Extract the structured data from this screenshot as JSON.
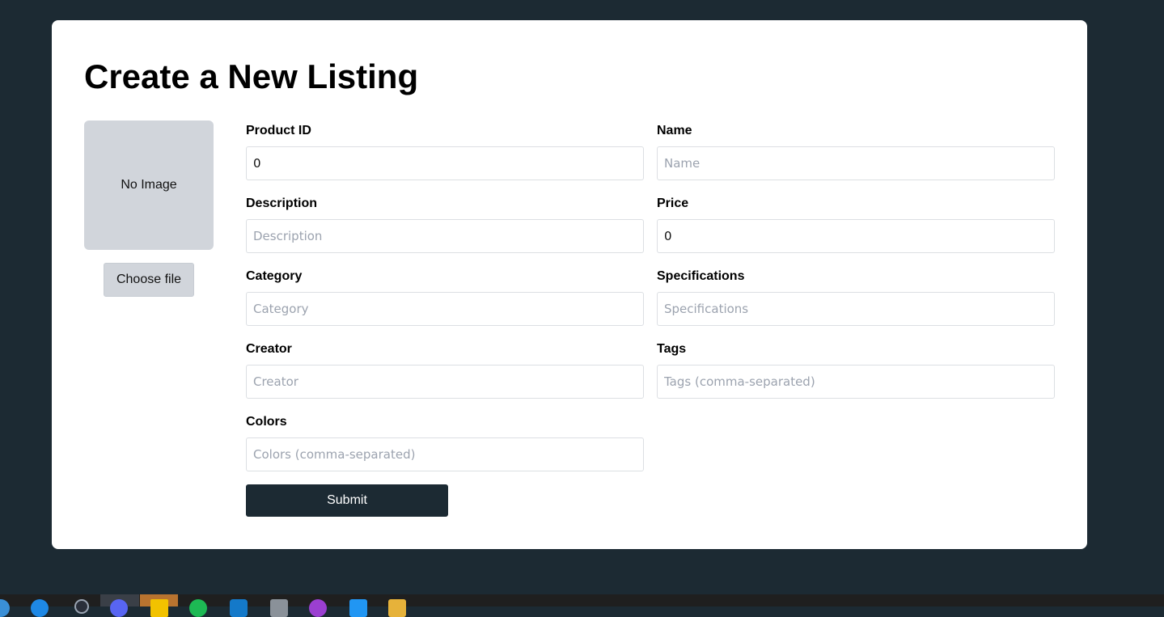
{
  "form": {
    "title": "Create a New Listing",
    "image_placeholder": "No Image",
    "choose_file_label": "Choose file",
    "fields": [
      {
        "label": "Product ID",
        "value": "0",
        "placeholder": ""
      },
      {
        "label": "Name",
        "value": "",
        "placeholder": "Name"
      },
      {
        "label": "Description",
        "value": "",
        "placeholder": "Description"
      },
      {
        "label": "Price",
        "value": "0",
        "placeholder": ""
      },
      {
        "label": "Category",
        "value": "",
        "placeholder": "Category"
      },
      {
        "label": "Specifications",
        "value": "",
        "placeholder": "Specifications"
      },
      {
        "label": "Creator",
        "value": "",
        "placeholder": "Creator"
      },
      {
        "label": "Tags",
        "value": "",
        "placeholder": "Tags (comma-separated)"
      },
      {
        "label": "Colors",
        "value": "",
        "placeholder": "Colors (comma-separated)"
      }
    ],
    "submit_label": "Submit"
  },
  "colors": {
    "page_background": "#1c2a33",
    "card_background": "#ffffff",
    "submit_background": "#1c2a33",
    "image_placeholder_background": "#d1d5db"
  },
  "taskbar": {
    "icons": [
      "search-icon",
      "edge-browser-icon",
      "user-icon",
      "discord-icon",
      "file-explorer-icon",
      "spotify-icon",
      "shield-icon",
      "app-icon",
      "podcast-icon",
      "vscode-icon",
      "folder-icon"
    ]
  }
}
